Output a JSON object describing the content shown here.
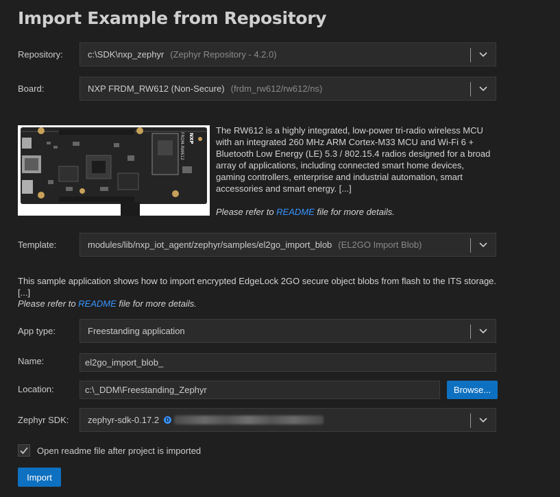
{
  "page": {
    "title": "Import Example from Repository"
  },
  "repository": {
    "label": "Repository:",
    "value": "c:\\SDK\\nxp_zephyr",
    "detail": "(Zephyr Repository - 4.2.0)"
  },
  "board": {
    "label": "Board:",
    "value": "NXP FRDM_RW612 (Non-Secure)",
    "detail": "(frdm_rw612/rw612/ns)",
    "image_text": "FRDM-RW612",
    "logo_text": "NXP",
    "description": "The RW612 is a highly integrated, low-power tri-radio wireless MCU with an integrated 260 MHz ARM Cortex-M33 MCU and Wi-Fi 6 + Bluetooth Low Energy (LE) 5.3 / 802.15.4 radios designed for a broad array of applications, including connected smart home devices, gaming controllers, enterprise and industrial automation, smart accessories and smart energy. [...]",
    "refer_prefix": "Please refer to ",
    "refer_link": "README",
    "refer_suffix": " file for more details."
  },
  "template": {
    "label": "Template:",
    "value": "modules/lib/nxp_iot_agent/zephyr/samples/el2go_import_blob",
    "detail": "(EL2GO Import Blob)",
    "description": "This sample application shows how to import encrypted EdgeLock 2GO secure object blobs from flash to the ITS storage. [...]",
    "refer_prefix": "Please refer to ",
    "refer_link": "README",
    "refer_suffix": " file for more details."
  },
  "app_type": {
    "label": "App type:",
    "value": "Freestanding application"
  },
  "name": {
    "label": "Name:",
    "value": "el2go_import_blob_"
  },
  "location": {
    "label": "Location:",
    "value": "c:\\_DDM\\Freestanding_Zephyr",
    "browse_label": "Browse..."
  },
  "zephyr_sdk": {
    "label": "Zephyr SDK:",
    "value": "zephyr-sdk-0.17.2",
    "badge": "D"
  },
  "open_readme": {
    "label": "Open readme file after project is imported",
    "checked": true
  },
  "import_button": {
    "label": "Import"
  },
  "colors": {
    "background": "#1f1f1f",
    "input_bg": "#2b2b2b",
    "accent": "#0e70c0",
    "link": "#3794ff"
  },
  "icons": {
    "dropdown": "chevron-down-icon",
    "checkbox": "checkmark-icon"
  }
}
